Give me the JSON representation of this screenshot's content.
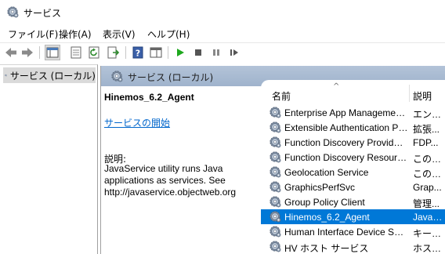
{
  "window": {
    "title": "サービス"
  },
  "menu": [
    "ファイル(F)",
    "操作(A)",
    "表示(V)",
    "ヘルプ(H)"
  ],
  "toolbar": {
    "icons": [
      "back-icon",
      "forward-icon",
      "console-tree-icon",
      "properties-icon",
      "refresh-icon",
      "export-list-icon",
      "help-icon",
      "view-icon",
      "start-icon",
      "stop-icon",
      "pause-icon",
      "restart-icon"
    ]
  },
  "tree": {
    "selected": "サービス (ローカル)"
  },
  "panel": {
    "header": "サービス (ローカル)"
  },
  "detail": {
    "service_name": "Hinemos_6.2_Agent",
    "start_link": "サービスの開始",
    "desc_label": "説明:",
    "desc_text": "JavaService utility runs Java applications as services. See http://javaservice.objectweb.org"
  },
  "list": {
    "col_name": "名前",
    "col_desc": "説明",
    "sort_indicator": "^",
    "rows": [
      {
        "name": "Enterprise App Management Service",
        "desc": "エンタ..."
      },
      {
        "name": "Extensible Authentication Protocol",
        "desc": "拡張..."
      },
      {
        "name": "Function Discovery Provider Host",
        "desc": "FDP..."
      },
      {
        "name": "Function Discovery Resource Publication",
        "desc": "このコ..."
      },
      {
        "name": "Geolocation Service",
        "desc": "このサ..."
      },
      {
        "name": "GraphicsPerfSvc",
        "desc": "Grap..."
      },
      {
        "name": "Group Policy Client",
        "desc": "管理..."
      },
      {
        "name": "Hinemos_6.2_Agent",
        "desc": "JavaS...",
        "selected": true
      },
      {
        "name": "Human Interface Device Service",
        "desc": "キーボ..."
      },
      {
        "name": "HV ホスト サービス",
        "desc": "ホスト..."
      }
    ]
  },
  "colors": {
    "selection": "#0078d7",
    "link": "#0066cc",
    "header_band": "#a9bbd2"
  }
}
